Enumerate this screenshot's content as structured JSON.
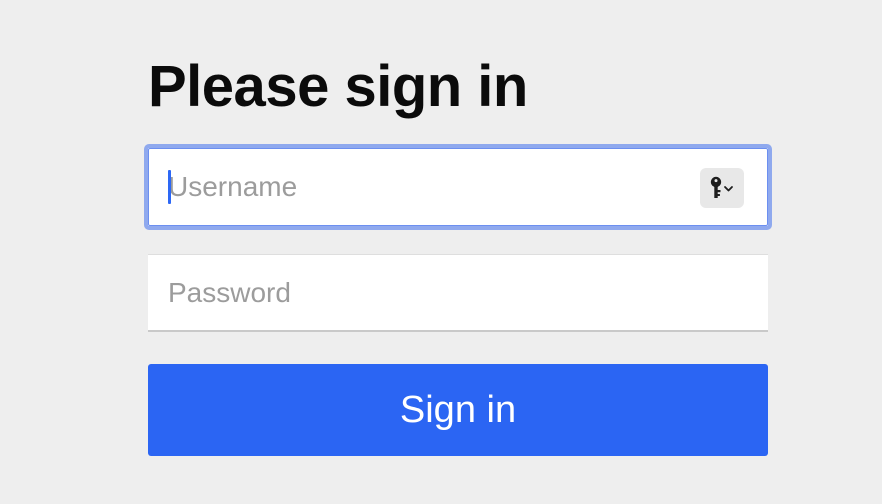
{
  "page": {
    "heading": "Please sign in"
  },
  "form": {
    "username": {
      "value": "",
      "placeholder": "Username"
    },
    "password": {
      "value": "",
      "placeholder": "Password"
    },
    "submit_label": "Sign in"
  },
  "icons": {
    "password_manager": "key-icon",
    "dropdown": "chevron-down-icon"
  },
  "colors": {
    "background": "#eeeeee",
    "focus_ring": "#8fa9ee",
    "caret": "#2d68f5",
    "button": "#2b65f3",
    "button_text": "#ffffff"
  }
}
